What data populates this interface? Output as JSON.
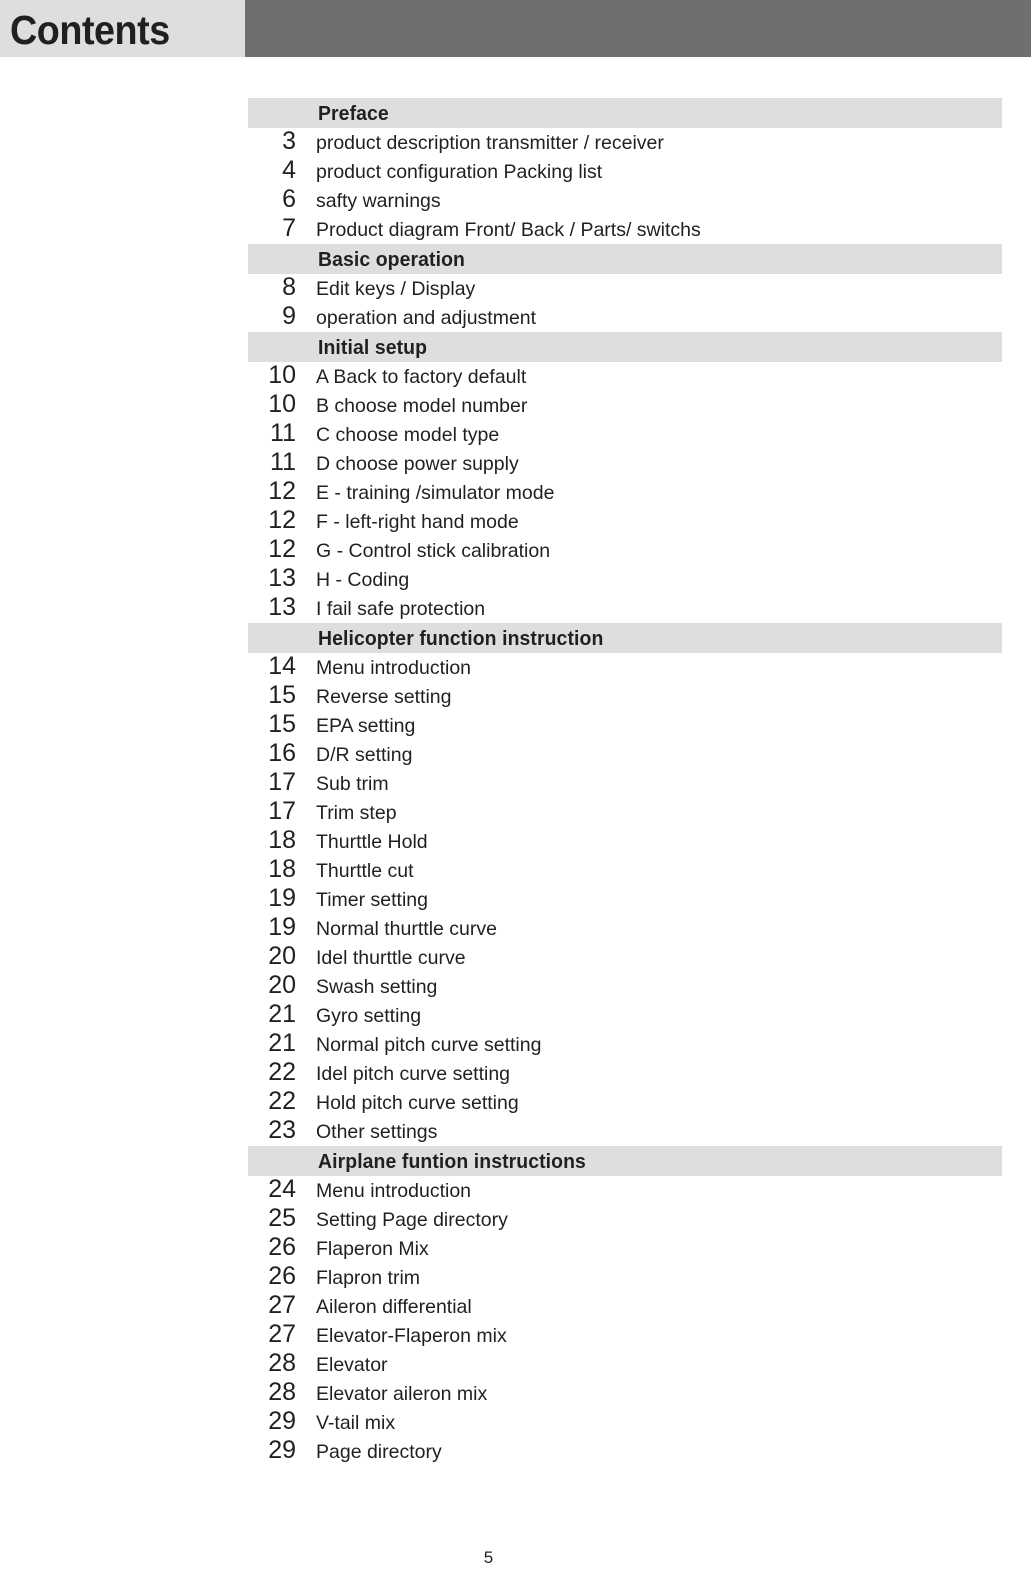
{
  "header": {
    "title": "Contents",
    "left_band_color": "#dedede",
    "right_band_color": "#706f6e"
  },
  "colors": {
    "section_band": "#dedede",
    "text": "#231f20",
    "page_background": "#ffffff"
  },
  "toc": {
    "sections": [
      {
        "label": "Preface",
        "entries": [
          {
            "page": "3",
            "title": "product description  transmitter / receiver"
          },
          {
            "page": "4",
            "title": "product configuration  Packing list"
          },
          {
            "page": "6",
            "title": "safty warnings"
          },
          {
            "page": "7",
            "title": "Product diagram  Front/ Back / Parts/ switchs"
          }
        ]
      },
      {
        "label": "Basic operation",
        "entries": [
          {
            "page": "8",
            "title": "Edit keys / Display"
          },
          {
            "page": "9",
            "title": "operation and adjustment"
          }
        ]
      },
      {
        "label": "Initial setup",
        "entries": [
          {
            "page": "10",
            "title": "A  Back to factory default"
          },
          {
            "page": "10",
            "title": "B  choose model number"
          },
          {
            "page": "11",
            "title": "C  choose model type"
          },
          {
            "page": "11",
            "title": "D  choose power supply"
          },
          {
            "page": "12",
            "title": "E - training /simulator mode"
          },
          {
            "page": "12",
            "title": "F - left-right hand mode"
          },
          {
            "page": "12",
            "title": "G - Control stick calibration"
          },
          {
            "page": "13",
            "title": "H - Coding"
          },
          {
            "page": "13",
            "title": "I  fail safe protection"
          }
        ]
      },
      {
        "label": "Helicopter function instruction",
        "entries": [
          {
            "page": "14",
            "title": "Menu introduction"
          },
          {
            "page": "15",
            "title": "Reverse setting"
          },
          {
            "page": "15",
            "title": "EPA setting"
          },
          {
            "page": "16",
            "title": "D/R setting"
          },
          {
            "page": "17",
            "title": "Sub trim"
          },
          {
            "page": "17",
            "title": "Trim step"
          },
          {
            "page": "18",
            "title": "Thurttle Hold"
          },
          {
            "page": "18",
            "title": "Thurttle cut"
          },
          {
            "page": "19",
            "title": "Timer setting"
          },
          {
            "page": "19",
            "title": "Normal thurttle curve"
          },
          {
            "page": "20",
            "title": "Idel thurttle curve"
          },
          {
            "page": "20",
            "title": "Swash setting"
          },
          {
            "page": "21",
            "title": "Gyro setting"
          },
          {
            "page": "21",
            "title": "Normal pitch curve setting"
          },
          {
            "page": "22",
            "title": "Idel pitch curve setting"
          },
          {
            "page": "22",
            "title": "Hold pitch curve setting"
          },
          {
            "page": "23",
            "title": "Other settings"
          }
        ]
      },
      {
        "label": "Airplane funtion instructions",
        "entries": [
          {
            "page": "24",
            "title": "Menu introduction"
          },
          {
            "page": "25",
            "title": "Setting Page directory"
          },
          {
            "page": "26",
            "title": "Flaperon Mix"
          },
          {
            "page": "26",
            "title": "Flapron trim"
          },
          {
            "page": "27",
            "title": "Aileron differential"
          },
          {
            "page": "27",
            "title": "Elevator-Flaperon mix"
          },
          {
            "page": "28",
            "title": "Elevator"
          },
          {
            "page": "28",
            "title": "Elevator aileron mix"
          },
          {
            "page": "29",
            "title": "V-tail mix"
          },
          {
            "page": "29",
            "title": "Page directory"
          }
        ]
      }
    ]
  },
  "footer": {
    "page_number": "5"
  }
}
